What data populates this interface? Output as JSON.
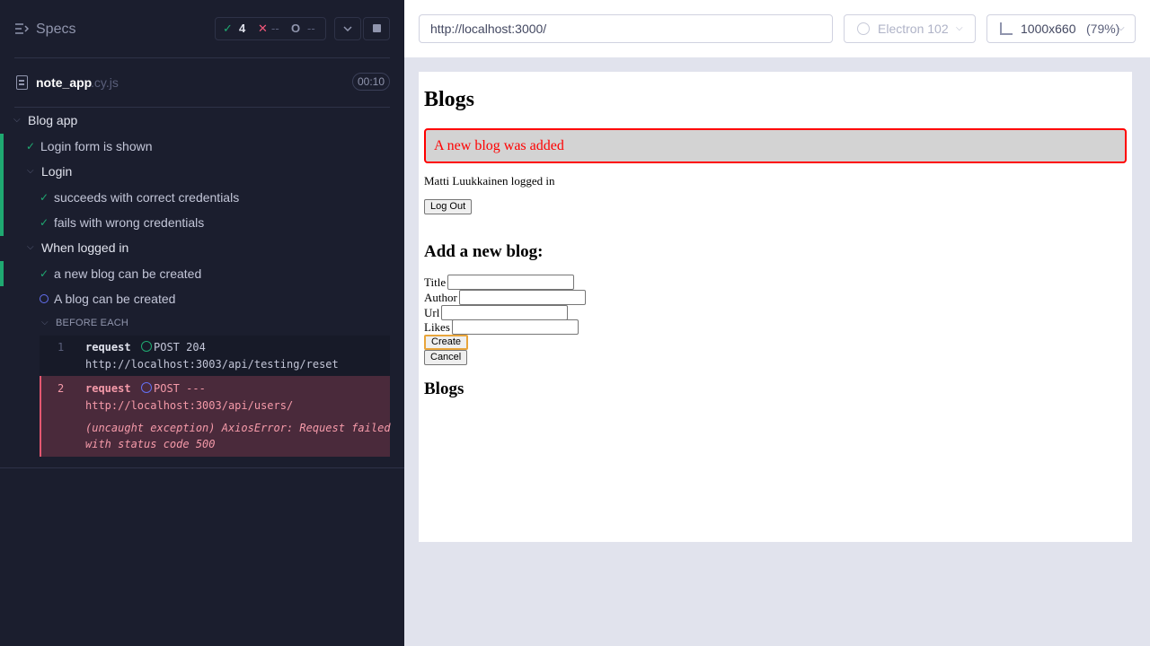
{
  "reporter": {
    "title": "Specs",
    "stats": {
      "passed": "4",
      "failed": "--",
      "pending": "--"
    },
    "spec_file": {
      "name": "note_app",
      "ext": ".cy.js",
      "duration": "00:10"
    },
    "tree": {
      "root": "Blog app",
      "login_form": "Login form is shown",
      "login_suite": "Login",
      "login_ok": "succeeds with correct credentials",
      "login_fail": "fails with wrong credentials",
      "logged_suite": "When logged in",
      "new_blog": "a new blog can be created",
      "running_test": "A blog can be created",
      "hook": "BEFORE EACH"
    },
    "commands": [
      {
        "num": "1",
        "name": "request",
        "method": "POST 204",
        "url": "http://localhost:3003/api/testing/reset"
      },
      {
        "num": "2",
        "name": "request",
        "method": "POST ---",
        "url": "http://localhost:3003/api/users/",
        "error_line1": "(uncaught exception)  AxiosError: Request failed",
        "error_line2": "with status code 500"
      }
    ]
  },
  "aut": {
    "url": "http://localhost:3000/",
    "browser": "Electron 102",
    "viewport": "1000x660",
    "scale": "(79%)"
  },
  "app": {
    "heading": "Blogs",
    "notification": "A new blog was added",
    "logged_in": "Matti Luukkainen logged in",
    "logout_label": "Log Out",
    "form_heading": "Add a new blog:",
    "fields": {
      "title": "Title",
      "author": "Author",
      "url": "Url",
      "likes": "Likes"
    },
    "create_label": "Create",
    "cancel_label": "Cancel",
    "list_heading": "Blogs"
  },
  "colors": {
    "pass": "#1fa971",
    "fail": "#f2577a",
    "pending": "#6470f3",
    "notification": "#ff0000"
  }
}
